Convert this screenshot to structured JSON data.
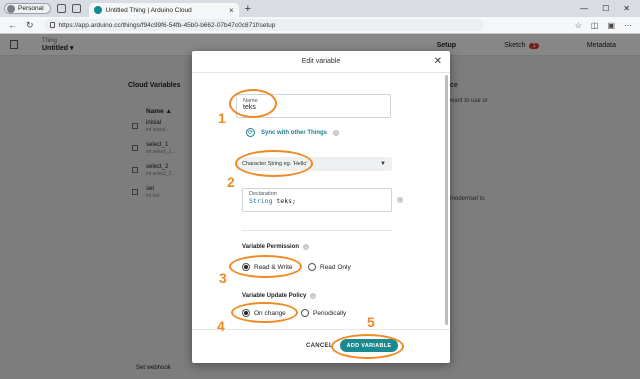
{
  "browser": {
    "profile_label": "Personal",
    "tab_title": "Untitled Thing | Arduino Cloud",
    "new_tab_label": "+",
    "url": "https://app.arduino.cc/things/f94c99f6-54fb-45b0-b662-07b47c0c871f/setup",
    "window_controls": [
      "—",
      "☐",
      "✕"
    ]
  },
  "page": {
    "thing_label": "Thing",
    "thing_name": "Untitled ▾",
    "tabs": [
      {
        "label": "Setup"
      },
      {
        "label": "Sketch",
        "badge": "1"
      },
      {
        "label": "Metadata"
      }
    ],
    "cloud_variables_title": "Cloud Variables",
    "column_name": "Name ▲",
    "variables": [
      {
        "name": "inisial",
        "sub": "int inisial..."
      },
      {
        "name": "select_1",
        "sub": "int select_1..."
      },
      {
        "name": "select_2",
        "sub": "int select_2..."
      },
      {
        "name": "set",
        "sub": "int set"
      }
    ],
    "set_webhook": "Set webhook",
    "side_text_1": "ce",
    "side_text_2": "want to use or",
    "side_text_3": "modemset to"
  },
  "modal": {
    "title": "Edit variable",
    "name_label": "Name",
    "name_value": "teks",
    "sync_label": "Sync with other Things",
    "type_value": "Character String  eg. 'Hello'",
    "declaration_label": "Declaration",
    "declaration_keyword": "String",
    "declaration_rest": " teks;",
    "permission_title": "Variable Permission",
    "permission_options": [
      "Read & Write",
      "Read Only"
    ],
    "permission_selected": "Read & Write",
    "update_title": "Variable Update Policy",
    "update_options": [
      "On change",
      "Periodically"
    ],
    "update_selected": "On change",
    "cancel_label": "CANCEL",
    "add_label": "ADD VARIABLE"
  },
  "annotations": [
    "1",
    "2",
    "3",
    "4",
    "5"
  ],
  "colors": {
    "accent": "#1a8a8f",
    "annotation": "#f08a24",
    "badge": "#c23b22"
  }
}
